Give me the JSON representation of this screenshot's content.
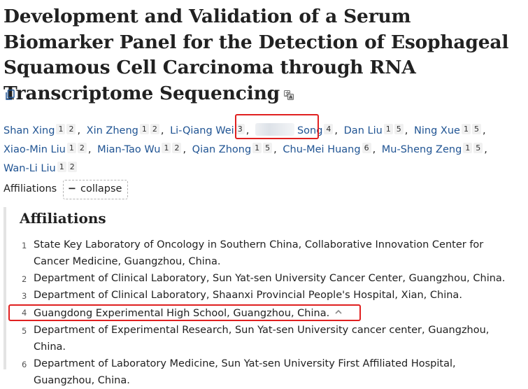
{
  "article": {
    "title": "Development and Validation of a Serum Biomarker Panel for the Detection of Esophageal Squamous Cell Carcinoma through RNA Transcriptome Sequencing",
    "translate_icon": "translate-icon",
    "copy_icon": "copy-icon"
  },
  "authors": [
    {
      "name": "Shan Xing",
      "sups": [
        "1",
        "2"
      ]
    },
    {
      "name": "Xin Zheng",
      "sups": [
        "1",
        "2"
      ]
    },
    {
      "name": "Li-Qiang Wei",
      "sups": [
        "3"
      ]
    },
    {
      "name": "Song",
      "sups": [
        "4"
      ],
      "redacted_prefix": true
    },
    {
      "name": "Dan Liu",
      "sups": [
        "1",
        "5"
      ]
    },
    {
      "name": "Ning Xue",
      "sups": [
        "1",
        "5"
      ]
    },
    {
      "name": "Xiao-Min Liu",
      "sups": [
        "1",
        "2"
      ]
    },
    {
      "name": "Mian-Tao Wu",
      "sups": [
        "1",
        "2"
      ]
    },
    {
      "name": "Qian Zhong",
      "sups": [
        "1",
        "5"
      ]
    },
    {
      "name": "Chu-Mei Huang",
      "sups": [
        "6"
      ]
    },
    {
      "name": "Mu-Sheng Zeng",
      "sups": [
        "1",
        "5"
      ]
    },
    {
      "name": "Wan-Li Liu",
      "sups": [
        "1",
        "2"
      ]
    }
  ],
  "affiliations_toggle": {
    "label": "Affiliations",
    "button_label": "collapse",
    "button_icon": "minus-icon"
  },
  "affiliations": {
    "heading": "Affiliations",
    "items": [
      {
        "num": "1",
        "text": "State Key Laboratory of Oncology in Southern China, Collaborative Innovation Center for Cancer Medicine, Guangzhou, China."
      },
      {
        "num": "2",
        "text": "Department of Clinical Laboratory, Sun Yat-sen University Cancer Center, Guangzhou, China."
      },
      {
        "num": "3",
        "text": "Department of Clinical Laboratory, Shaanxi Provincial People's Hospital, Xian, China."
      },
      {
        "num": "4",
        "text": "Guangdong Experimental High School, Guangzhou, China.",
        "highlighted": true
      },
      {
        "num": "5",
        "text": "Department of Experimental Research, Sun Yat-sen University cancer center, Guangzhou, China."
      },
      {
        "num": "6",
        "text": "Department of Laboratory Medicine, Sun Yat-sen University First Affiliated Hospital, Guangzhou, China."
      }
    ]
  },
  "colors": {
    "link": "#205493",
    "highlight_box": "#e02020",
    "text": "#212121"
  }
}
